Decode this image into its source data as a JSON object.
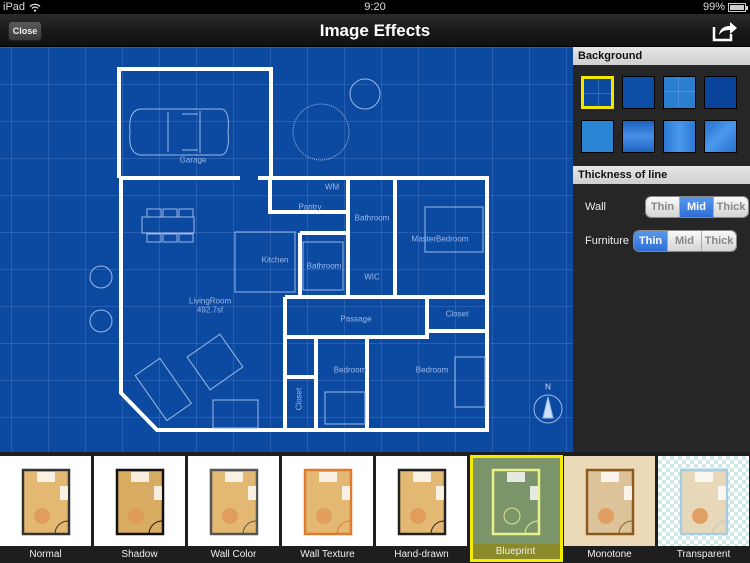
{
  "status_bar": {
    "device": "iPad",
    "time": "9:20",
    "battery": "99%",
    "battery_level": 0.99
  },
  "nav": {
    "close_label": "Close",
    "title": "Image Effects",
    "share_icon": "share-icon"
  },
  "canvas": {
    "background_color": "#0b4aa0",
    "rooms": [
      {
        "name": "Garage"
      },
      {
        "name": "WM"
      },
      {
        "name": "Pantry"
      },
      {
        "name": "Bathroom"
      },
      {
        "name": "MasterBedroom"
      },
      {
        "name": "Kitchen"
      },
      {
        "name": "Bathroom"
      },
      {
        "name": "WIC"
      },
      {
        "name": "LivingRoom"
      },
      {
        "name": "492.7sf"
      },
      {
        "name": "Passage"
      },
      {
        "name": "Closet"
      },
      {
        "name": "Bedroom"
      },
      {
        "name": "Bedroom"
      },
      {
        "name": "Closet"
      }
    ],
    "compass_label": "N"
  },
  "side_panel": {
    "background_header": "Background",
    "swatches": [
      {
        "color": "#0b4aa0",
        "selected": true
      },
      {
        "color": "#0c4ea6",
        "selected": false
      },
      {
        "color": "#2a80cf",
        "selected": false
      },
      {
        "color": "#0a439a",
        "selected": false
      },
      {
        "color": "#2a86d4",
        "selected": false
      },
      {
        "color": "#1b62c0",
        "selected": false
      },
      {
        "color": "#2c78d4",
        "selected": false
      },
      {
        "color": "#2670cc",
        "selected": false
      }
    ],
    "thickness_header": "Thickness of line",
    "rows": [
      {
        "label": "Wall",
        "options": [
          "Thin",
          "Mid",
          "Thick"
        ],
        "selected": "Mid"
      },
      {
        "label": "Furniture",
        "options": [
          "Thin",
          "Mid",
          "Thick"
        ],
        "selected": "Thin"
      }
    ]
  },
  "effects": [
    {
      "label": "Normal",
      "selected": false
    },
    {
      "label": "Shadow",
      "selected": false
    },
    {
      "label": "Wall Color",
      "selected": false
    },
    {
      "label": "Wall Texture",
      "selected": false
    },
    {
      "label": "Hand-drawn",
      "selected": false
    },
    {
      "label": "Blueprint",
      "selected": true
    },
    {
      "label": "Monotone",
      "selected": false
    },
    {
      "label": "Transparent",
      "selected": false
    }
  ]
}
